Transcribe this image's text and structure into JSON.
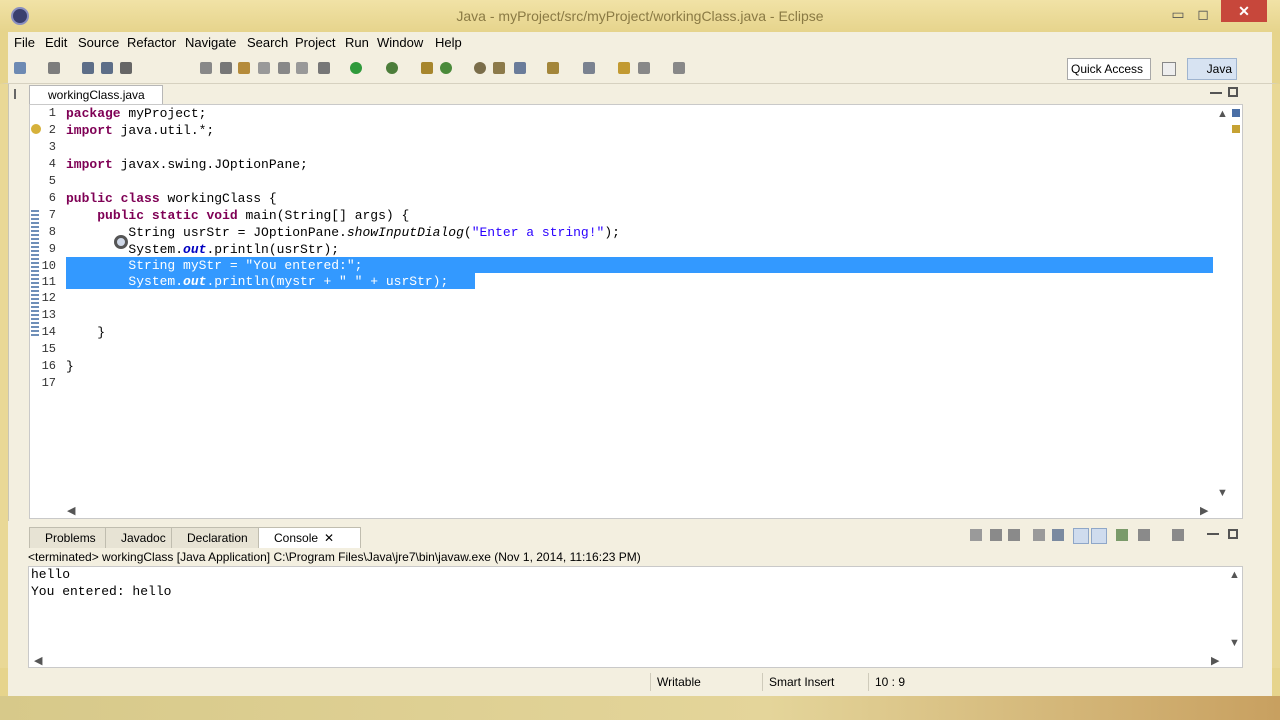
{
  "window": {
    "title": "Java - myProject/src/myProject/workingClass.java - Eclipse",
    "close": "✕",
    "minimize": "▭",
    "maximize": "◻"
  },
  "menu": [
    "File",
    "Edit",
    "Source",
    "Refactor",
    "Navigate",
    "Search",
    "Project",
    "Run",
    "Window",
    "Help"
  ],
  "toolbar": {
    "quick_access": "Quick Access",
    "perspective": "Java"
  },
  "editor": {
    "tab_label": "workingClass.java",
    "tab_close": "✕",
    "lines": [
      {
        "n": "1",
        "code": "package myProject;"
      },
      {
        "n": "2",
        "code": "import java.util.*;"
      },
      {
        "n": "3",
        "code": ""
      },
      {
        "n": "4",
        "code": "import javax.swing.JOptionPane;"
      },
      {
        "n": "5",
        "code": ""
      },
      {
        "n": "6",
        "code": "public class workingClass {"
      },
      {
        "n": "7",
        "code": "    public static void main(String[] args) {"
      },
      {
        "n": "8",
        "code": "        String usrStr = JOptionPane.showInputDialog(\"Enter a string!\");"
      },
      {
        "n": "9",
        "code": "        System.out.println(usrStr);"
      },
      {
        "n": "10",
        "code": "        String myStr = \"You entered:\";"
      },
      {
        "n": "11",
        "code": "        System.out.println(mystr + \" \" + usrStr);"
      },
      {
        "n": "12",
        "code": ""
      },
      {
        "n": "13",
        "code": ""
      },
      {
        "n": "14",
        "code": "    }"
      },
      {
        "n": "15",
        "code": ""
      },
      {
        "n": "16",
        "code": "}"
      },
      {
        "n": "17",
        "code": ""
      }
    ]
  },
  "views": {
    "tabs": [
      "Problems",
      "Javadoc",
      "Declaration",
      "Console"
    ],
    "console_header": "<terminated> workingClass [Java Application] C:\\Program Files\\Java\\jre7\\bin\\javaw.exe (Nov 1, 2014, 11:16:23 PM)",
    "output": [
      "hello",
      "You entered: hello"
    ]
  },
  "status": {
    "writable": "Writable",
    "insert_mode": "Smart Insert",
    "position": "10 : 9"
  },
  "colors": {
    "keyword": "#7f0055",
    "string": "#2a00ff",
    "selection": "#3399ff",
    "titlebar": "#e6d48c"
  }
}
